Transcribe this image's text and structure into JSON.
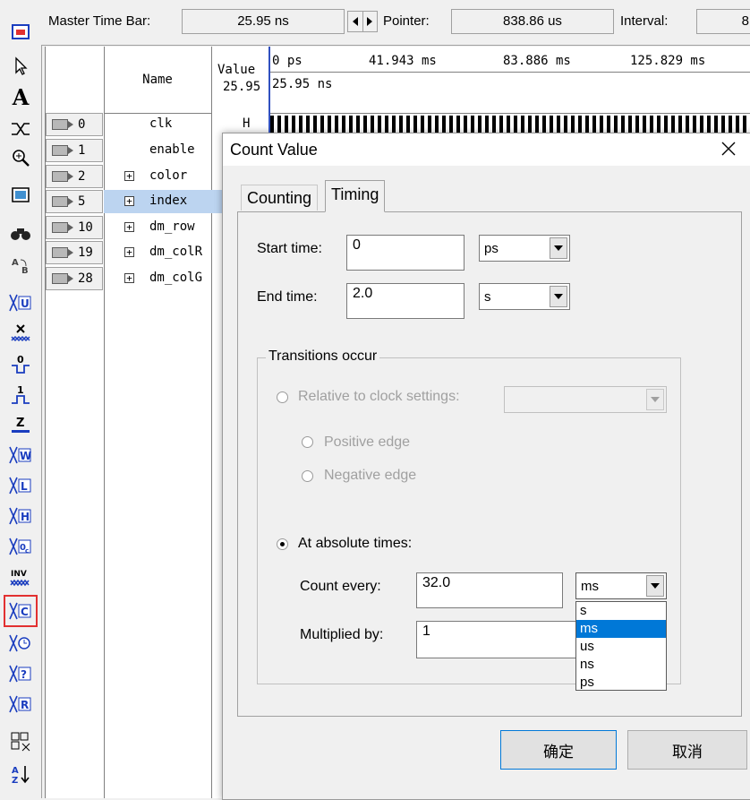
{
  "topbar": {
    "master_label": "Master Time Bar:",
    "master_value": "25.95 ns",
    "pointer_label": "Pointer:",
    "pointer_value": "838.86 us",
    "interval_label": "Interval:",
    "interval_value": "8"
  },
  "grid": {
    "name_header": "Name",
    "value_header": "Value",
    "value_sub": "25.95",
    "rows": [
      {
        "id": "0",
        "name": "clk",
        "expand": false,
        "value": "H"
      },
      {
        "id": "1",
        "name": "enable",
        "expand": false,
        "value": ""
      },
      {
        "id": "2",
        "name": "color",
        "expand": true,
        "value": ""
      },
      {
        "id": "5",
        "name": "index",
        "expand": true,
        "value": ""
      },
      {
        "id": "10",
        "name": "dm_row",
        "expand": true,
        "value": ""
      },
      {
        "id": "19",
        "name": "dm_colR",
        "expand": true,
        "value": ""
      },
      {
        "id": "28",
        "name": "dm_colG",
        "expand": true,
        "value": ""
      }
    ]
  },
  "wave": {
    "ruler": [
      "0 ps",
      "41.943 ms",
      "83.886 ms",
      "125.829 ms"
    ],
    "cursor_label": "25.95 ns"
  },
  "dialog": {
    "title": "Count Value",
    "tabs": [
      "Counting",
      "Timing"
    ],
    "active_tab": "Timing",
    "start_label": "Start time:",
    "start_value": "0",
    "start_unit": "ps",
    "end_label": "End time:",
    "end_value": "2.0",
    "end_unit": "s",
    "group_label": "Transitions occur",
    "relative_label": "Relative to clock settings:",
    "positive_label": "Positive edge",
    "negative_label": "Negative edge",
    "absolute_label": "At absolute times:",
    "count_label": "Count every:",
    "count_value": "32.0",
    "count_unit": "ms",
    "mult_label": "Multiplied by:",
    "mult_value": "1",
    "unit_options": [
      "s",
      "ms",
      "us",
      "ns",
      "ps"
    ],
    "ok_label": "确定",
    "cancel_label": "取消"
  },
  "toolbar": {
    "items": [
      "A",
      "U",
      "0",
      "1",
      "Z",
      "W",
      "L",
      "H",
      "INV",
      "C",
      "?",
      "R"
    ]
  }
}
